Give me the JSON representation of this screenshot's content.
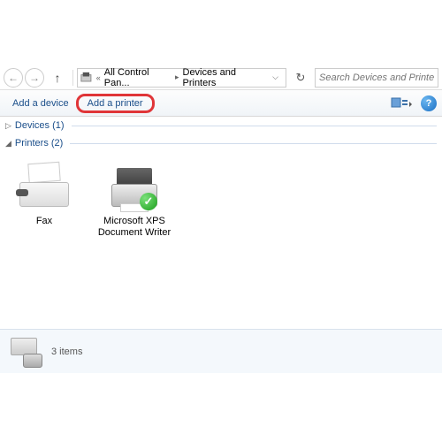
{
  "nav": {
    "back": "←",
    "fwd": "→",
    "up": "↑"
  },
  "breadcrumb": {
    "prefix": "«",
    "part1": "All Control Pan...",
    "part2": "Devices and Printers"
  },
  "refresh": "↻",
  "search_placeholder": "Search Devices and Printers",
  "toolbar": {
    "add_device": "Add a device",
    "add_printer": "Add a printer",
    "help": "?"
  },
  "groups": {
    "devices": {
      "tri": "▷",
      "label": "Devices (1)"
    },
    "printers": {
      "tri": "◢",
      "label": "Printers (2)"
    }
  },
  "printers": {
    "fax": {
      "label": "Fax"
    },
    "xps": {
      "label": "Microsoft XPS Document Writer",
      "check": "✓"
    }
  },
  "status": {
    "count": "3 items"
  }
}
